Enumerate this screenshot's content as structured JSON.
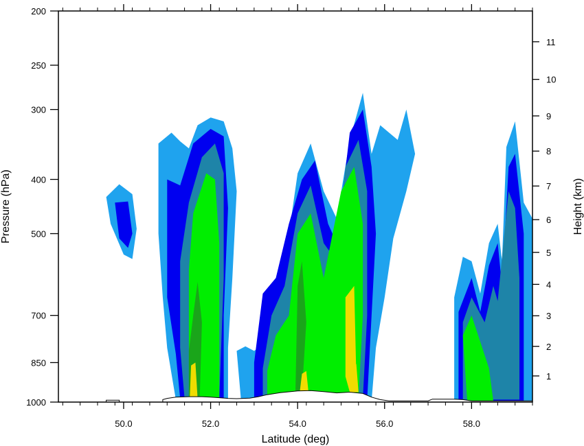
{
  "chart_data": {
    "type": "contour",
    "xlabel": "Latitude (deg)",
    "ylabel_left": "Pressure (hPa)",
    "ylabel_right": "Height (km)",
    "x_range": [
      48.5,
      59.4
    ],
    "x_ticks": [
      {
        "value": 50.0,
        "label": "50.0"
      },
      {
        "value": 52.0,
        "label": "52.0"
      },
      {
        "value": 54.0,
        "label": "54.0"
      },
      {
        "value": 56.0,
        "label": "56.0"
      },
      {
        "value": 58.0,
        "label": "58.0"
      }
    ],
    "pressure_scale": "log",
    "pressure_range": [
      1000,
      200
    ],
    "pressure_ticks": [
      {
        "value": 200,
        "label": "200"
      },
      {
        "value": 250,
        "label": "250"
      },
      {
        "value": 300,
        "label": "300"
      },
      {
        "value": 400,
        "label": "400"
      },
      {
        "value": 500,
        "label": "500"
      },
      {
        "value": 700,
        "label": "700"
      },
      {
        "value": 850,
        "label": "850"
      },
      {
        "value": 1000,
        "label": "1000"
      }
    ],
    "height_ticks": [
      {
        "value": 1,
        "pressure": 898,
        "label": "1"
      },
      {
        "value": 2,
        "pressure": 795,
        "label": "2"
      },
      {
        "value": 3,
        "pressure": 701,
        "label": "3"
      },
      {
        "value": 4,
        "pressure": 616,
        "label": "4"
      },
      {
        "value": 5,
        "pressure": 540,
        "label": "5"
      },
      {
        "value": 6,
        "pressure": 472,
        "label": "6"
      },
      {
        "value": 7,
        "pressure": 411,
        "label": "7"
      },
      {
        "value": 8,
        "pressure": 356,
        "label": "8"
      },
      {
        "value": 9,
        "pressure": 308,
        "label": "9"
      },
      {
        "value": 10,
        "pressure": 265,
        "label": "10"
      },
      {
        "value": 11,
        "pressure": 227,
        "label": "11"
      }
    ],
    "level_colors": [
      "#1fa3ee",
      "#0000f0",
      "#1e84a8",
      "#00ee00",
      "#1aa51a",
      "#f0dc00"
    ],
    "terrain": [
      [
        48.5,
        1000
      ],
      [
        49.6,
        1000
      ],
      [
        49.6,
        992
      ],
      [
        49.9,
        992
      ],
      [
        49.9,
        1000
      ],
      [
        50.9,
        1000
      ],
      [
        50.9,
        990
      ],
      [
        51.0,
        985
      ],
      [
        51.2,
        980
      ],
      [
        51.5,
        978
      ],
      [
        51.8,
        978
      ],
      [
        52.0,
        980
      ],
      [
        52.2,
        982
      ],
      [
        52.4,
        985
      ],
      [
        52.6,
        986
      ],
      [
        52.9,
        984
      ],
      [
        53.1,
        978
      ],
      [
        53.3,
        970
      ],
      [
        53.6,
        962
      ],
      [
        54.0,
        955
      ],
      [
        54.3,
        954
      ],
      [
        54.6,
        958
      ],
      [
        54.9,
        963
      ],
      [
        55.2,
        960
      ],
      [
        55.5,
        965
      ],
      [
        55.7,
        980
      ],
      [
        55.9,
        990
      ],
      [
        56.1,
        995
      ],
      [
        57.0,
        995
      ],
      [
        57.1,
        988
      ],
      [
        57.6,
        988
      ],
      [
        57.8,
        990
      ],
      [
        58.0,
        995
      ],
      [
        58.6,
        995
      ],
      [
        59.4,
        995
      ],
      [
        59.4,
        1000
      ]
    ],
    "cells": [
      {
        "levels": [
          [
            [
              49.6,
              430
            ],
            [
              49.9,
              408
            ],
            [
              50.2,
              425
            ],
            [
              50.3,
              490
            ],
            [
              50.2,
              555
            ],
            [
              50.0,
              545
            ],
            [
              49.7,
              480
            ]
          ],
          [
            [
              49.8,
              440
            ],
            [
              50.1,
              438
            ],
            [
              50.2,
              500
            ],
            [
              50.1,
              530
            ],
            [
              49.9,
              510
            ]
          ]
        ]
      },
      {
        "levels": [
          [
            [
              50.8,
              345
            ],
            [
              51.1,
              330
            ],
            [
              51.3,
              342
            ],
            [
              51.5,
              352
            ],
            [
              51.7,
              320
            ],
            [
              52.0,
              310
            ],
            [
              52.3,
              315
            ],
            [
              52.5,
              352
            ],
            [
              52.6,
              420
            ],
            [
              52.5,
              600
            ],
            [
              52.4,
              800
            ],
            [
              52.4,
              990
            ],
            [
              51.2,
              990
            ],
            [
              51.0,
              800
            ],
            [
              50.9,
              650
            ],
            [
              50.8,
              500
            ]
          ],
          [
            [
              51.0,
              400
            ],
            [
              51.3,
              410
            ],
            [
              51.6,
              345
            ],
            [
              52.0,
              325
            ],
            [
              52.3,
              335
            ],
            [
              52.4,
              450
            ],
            [
              52.3,
              700
            ],
            [
              52.3,
              985
            ],
            [
              51.3,
              985
            ],
            [
              51.2,
              820
            ],
            [
              51.0,
              650
            ],
            [
              51.0,
              480
            ]
          ],
          [
            [
              51.3,
              560
            ],
            [
              51.5,
              440
            ],
            [
              51.8,
              365
            ],
            [
              52.1,
              345
            ],
            [
              52.3,
              390
            ],
            [
              52.3,
              600
            ],
            [
              52.2,
              985
            ],
            [
              51.4,
              985
            ],
            [
              51.3,
              800
            ]
          ],
          [
            [
              51.5,
              580
            ],
            [
              51.6,
              460
            ],
            [
              51.9,
              390
            ],
            [
              52.1,
              400
            ],
            [
              52.2,
              520
            ],
            [
              52.2,
              985
            ],
            [
              51.5,
              985
            ],
            [
              51.5,
              790
            ]
          ],
          [
            [
              51.5,
              810
            ],
            [
              51.6,
              700
            ],
            [
              51.7,
              610
            ],
            [
              51.8,
              720
            ],
            [
              51.75,
              985
            ],
            [
              51.5,
              985
            ]
          ],
          [
            [
              51.55,
              860
            ],
            [
              51.65,
              850
            ],
            [
              51.7,
              985
            ],
            [
              51.52,
              985
            ]
          ]
        ]
      },
      {
        "levels": [
          [
            [
              52.6,
              810
            ],
            [
              52.8,
              795
            ],
            [
              53.0,
              810
            ],
            [
              53.2,
              790
            ],
            [
              53.5,
              640
            ],
            [
              53.8,
              500
            ],
            [
              54.0,
              390
            ],
            [
              54.3,
              345
            ],
            [
              54.6,
              420
            ],
            [
              54.9,
              470
            ],
            [
              55.2,
              340
            ],
            [
              55.5,
              280
            ],
            [
              55.7,
              360
            ],
            [
              55.9,
              320
            ],
            [
              56.3,
              340
            ],
            [
              56.5,
              300
            ],
            [
              56.7,
              360
            ],
            [
              56.5,
              420
            ],
            [
              56.2,
              510
            ],
            [
              56.0,
              650
            ],
            [
              55.8,
              800
            ],
            [
              55.7,
              995
            ],
            [
              52.7,
              995
            ]
          ],
          [
            [
              53.0,
              850
            ],
            [
              53.2,
              640
            ],
            [
              53.5,
              600
            ],
            [
              53.8,
              480
            ],
            [
              54.1,
              400
            ],
            [
              54.4,
              370
            ],
            [
              54.7,
              480
            ],
            [
              54.9,
              520
            ],
            [
              55.2,
              330
            ],
            [
              55.5,
              300
            ],
            [
              55.7,
              380
            ],
            [
              55.8,
              500
            ],
            [
              55.7,
              700
            ],
            [
              55.6,
              990
            ],
            [
              53.0,
              990
            ]
          ],
          [
            [
              53.2,
              870
            ],
            [
              53.4,
              700
            ],
            [
              53.7,
              620
            ],
            [
              54.0,
              460
            ],
            [
              54.3,
              410
            ],
            [
              54.6,
              520
            ],
            [
              54.9,
              560
            ],
            [
              55.1,
              380
            ],
            [
              55.4,
              340
            ],
            [
              55.6,
              420
            ],
            [
              55.6,
              700
            ],
            [
              55.5,
              985
            ],
            [
              53.2,
              985
            ]
          ],
          [
            [
              53.3,
              880
            ],
            [
              53.5,
              760
            ],
            [
              53.8,
              700
            ],
            [
              54.0,
              500
            ],
            [
              54.3,
              460
            ],
            [
              54.6,
              600
            ],
            [
              55.0,
              420
            ],
            [
              55.3,
              380
            ],
            [
              55.5,
              480
            ],
            [
              55.5,
              700
            ],
            [
              55.4,
              985
            ],
            [
              53.3,
              985
            ]
          ],
          [
            [
              54.0,
              620
            ],
            [
              54.1,
              560
            ],
            [
              54.2,
              720
            ],
            [
              54.1,
              960
            ],
            [
              53.95,
              960
            ]
          ],
          [
            [
              55.1,
              650
            ],
            [
              55.3,
              620
            ],
            [
              55.35,
              900
            ],
            [
              55.2,
              960
            ],
            [
              55.1,
              900
            ]
          ],
          [
            [
              54.1,
              890
            ],
            [
              54.2,
              880
            ],
            [
              54.25,
              960
            ],
            [
              54.05,
              960
            ]
          ],
          [
            [
              55.2,
              860
            ],
            [
              55.35,
              855
            ],
            [
              55.4,
              960
            ],
            [
              55.2,
              960
            ]
          ]
        ]
      },
      {
        "levels": [
          [
            [
              57.6,
              650
            ],
            [
              57.8,
              550
            ],
            [
              58.0,
              560
            ],
            [
              58.2,
              640
            ],
            [
              58.4,
              520
            ],
            [
              58.6,
              480
            ],
            [
              58.7,
              560
            ],
            [
              58.8,
              350
            ],
            [
              59.0,
              315
            ],
            [
              59.2,
              440
            ],
            [
              59.4,
              470
            ],
            [
              59.4,
              995
            ],
            [
              57.6,
              995
            ]
          ],
          [
            [
              57.7,
              690
            ],
            [
              58.0,
              600
            ],
            [
              58.2,
              690
            ],
            [
              58.4,
              570
            ],
            [
              58.6,
              520
            ],
            [
              58.7,
              620
            ],
            [
              58.85,
              380
            ],
            [
              59.0,
              360
            ],
            [
              59.2,
              500
            ],
            [
              59.2,
              995
            ],
            [
              57.7,
              995
            ]
          ],
          [
            [
              57.8,
              720
            ],
            [
              58.0,
              650
            ],
            [
              58.3,
              720
            ],
            [
              58.5,
              620
            ],
            [
              58.6,
              660
            ],
            [
              58.85,
              420
            ],
            [
              59.0,
              450
            ],
            [
              59.1,
              600
            ],
            [
              59.1,
              990
            ],
            [
              57.8,
              990
            ]
          ],
          [
            [
              57.8,
              760
            ],
            [
              58.0,
              700
            ],
            [
              58.2,
              780
            ],
            [
              58.4,
              870
            ],
            [
              58.5,
              995
            ],
            [
              57.9,
              995
            ]
          ]
        ]
      }
    ]
  }
}
